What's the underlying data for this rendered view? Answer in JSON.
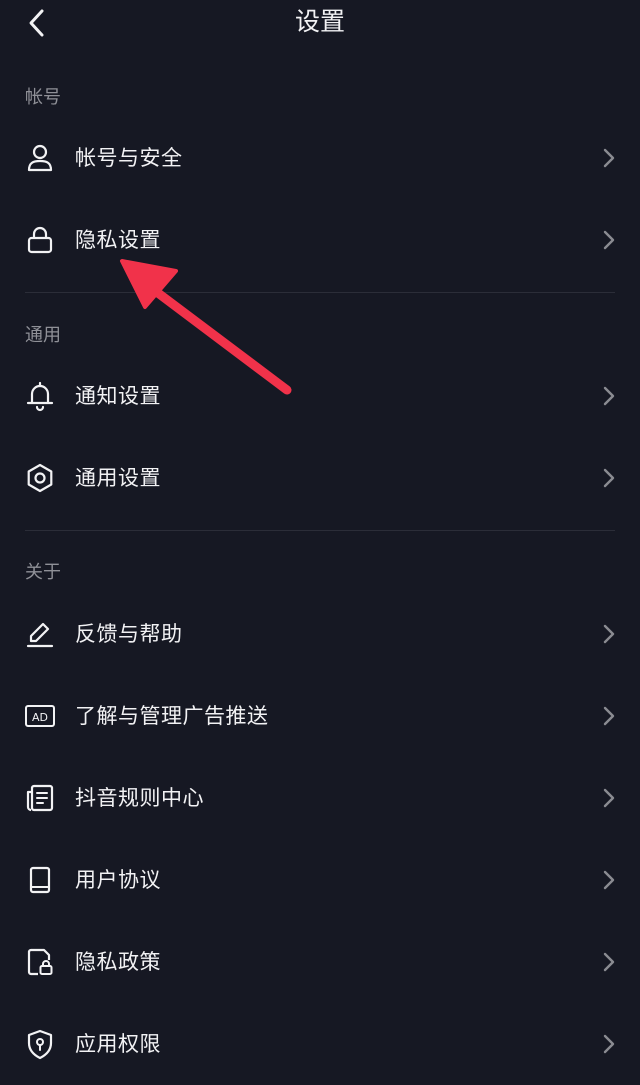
{
  "header": {
    "title": "设置",
    "back_icon": "chevron-left-icon"
  },
  "sections": [
    {
      "title": "帐号",
      "items": [
        {
          "label": "帐号与安全",
          "icon": "user-icon"
        },
        {
          "label": "隐私设置",
          "icon": "lock-icon"
        }
      ]
    },
    {
      "title": "通用",
      "items": [
        {
          "label": "通知设置",
          "icon": "bell-icon"
        },
        {
          "label": "通用设置",
          "icon": "gear-icon"
        }
      ]
    },
    {
      "title": "关于",
      "items": [
        {
          "label": "反馈与帮助",
          "icon": "pencil-icon"
        },
        {
          "label": "了解与管理广告推送",
          "icon": "ad-icon",
          "icon_text": "AD"
        },
        {
          "label": "抖音规则中心",
          "icon": "document-list-icon"
        },
        {
          "label": "用户协议",
          "icon": "book-icon"
        },
        {
          "label": "隐私政策",
          "icon": "privacy-document-icon"
        },
        {
          "label": "应用权限",
          "icon": "shield-icon"
        }
      ]
    }
  ],
  "colors": {
    "background": "#161823",
    "text": "#f2f2f4",
    "section_title": "#8f9097",
    "chevron": "#8a8b91",
    "divider": "#2b2d38",
    "annotation_arrow": "#f1324a"
  }
}
